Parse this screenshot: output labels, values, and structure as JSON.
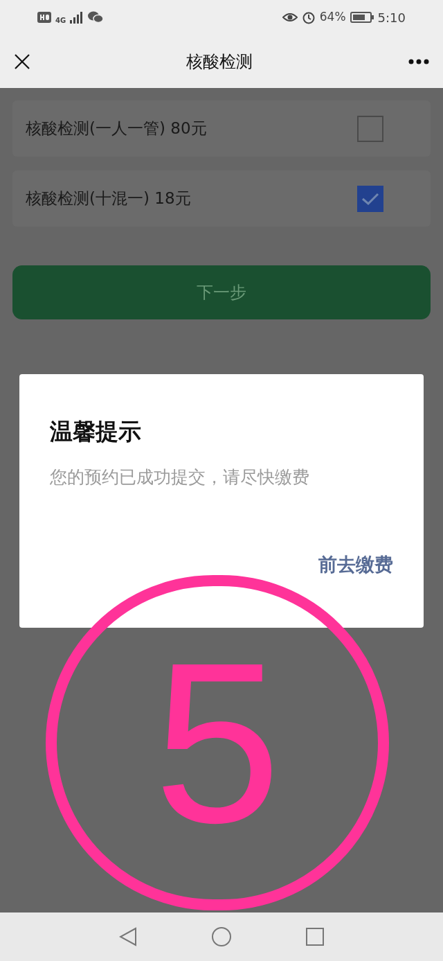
{
  "status_bar": {
    "network": "4G",
    "battery": "64%",
    "time": "5:10"
  },
  "header": {
    "title": "核酸检测"
  },
  "options": [
    {
      "label": "核酸检测(一人一管) 80元",
      "checked": false
    },
    {
      "label": "核酸检测(十混一) 18元",
      "checked": true
    }
  ],
  "next_button": {
    "label": "下一步"
  },
  "dialog": {
    "title": "温馨提示",
    "message": "您的预约已成功提交，请尽快缴费",
    "action": "前去缴费"
  },
  "annotation": {
    "label": "5"
  }
}
